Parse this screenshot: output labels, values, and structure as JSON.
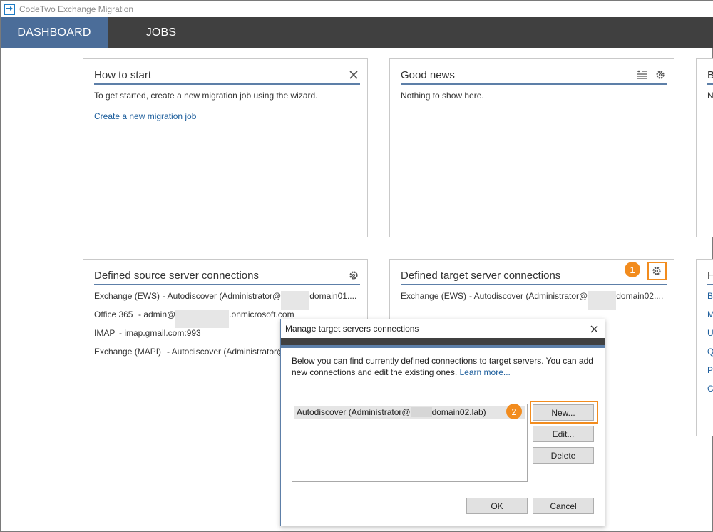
{
  "app": {
    "title": "CodeTwo Exchange Migration"
  },
  "nav": {
    "tabs": [
      {
        "label": "DASHBOARD",
        "active": true
      },
      {
        "label": "JOBS",
        "active": false
      }
    ]
  },
  "panels": {
    "how_to_start": {
      "title": "How to start",
      "text": "To get started, create a new migration job using the wizard.",
      "link": "Create a new migration job"
    },
    "good_news": {
      "title": "Good news",
      "text": "Nothing to show here."
    },
    "right_top": {
      "title": "B",
      "text": "N"
    },
    "source": {
      "title": "Defined source server connections",
      "rows": [
        {
          "type": "Exchange (EWS)",
          "pre": "- Autodiscover (Administrator@",
          "post": "domain01...."
        },
        {
          "type": "Office 365",
          "pre": "- admin@",
          "post": ".onmicrosoft.com"
        },
        {
          "type": "IMAP",
          "pre": "- imap.gmail.com:993",
          "post": ""
        },
        {
          "type": "Exchange (MAPI)",
          "pre": "- Autodiscover (Administrator@",
          "post": ""
        }
      ]
    },
    "target": {
      "title": "Defined target server connections",
      "rows": [
        {
          "type": "Exchange (EWS)",
          "pre": "- Autodiscover (Administrator@",
          "post": "domain02...."
        }
      ]
    },
    "right_bottom": {
      "title": "H",
      "links": [
        "B",
        "M",
        "U",
        "Q",
        "P",
        "C"
      ]
    }
  },
  "callouts": {
    "one": "1",
    "two": "2"
  },
  "dialog": {
    "title": "Manage target servers connections",
    "description": "Below you can find currently defined connections to target servers. You can add new connections and edit the existing ones.",
    "learn_more": "Learn more...",
    "list_item": {
      "pre": "Autodiscover (Administrator@",
      "post": "domain02.lab)"
    },
    "buttons": {
      "new": "New...",
      "edit": "Edit...",
      "delete": "Delete",
      "ok": "OK",
      "cancel": "Cancel"
    }
  },
  "colors": {
    "accent": "#4b6d99",
    "navbar": "#404040",
    "callout": "#f28c1e",
    "link": "#1d5e9c"
  },
  "icons": {
    "close": "close-icon",
    "gear": "gear-icon",
    "filter": "filter-icon"
  }
}
